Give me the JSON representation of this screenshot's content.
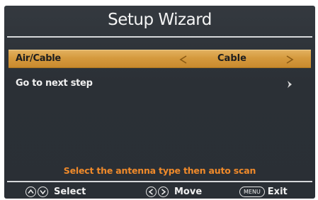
{
  "title": "Setup Wizard",
  "menu": {
    "air_cable": {
      "label": "Air/Cable",
      "value": "Cable"
    },
    "next_step": {
      "label": "Go to next step"
    }
  },
  "hint": "Select the antenna type then auto scan",
  "footer": {
    "select_label": "Select",
    "move_label": "Move",
    "menu_key": "MENU",
    "exit_label": "Exit"
  },
  "colors": {
    "highlight": "#d59a3e",
    "hint_text": "#f08a2a",
    "background": "#2b3036"
  }
}
